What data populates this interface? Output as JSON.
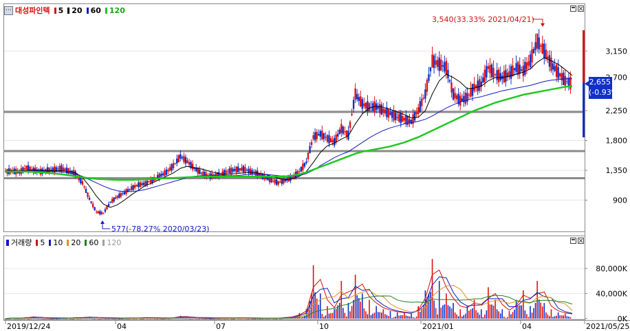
{
  "app": {
    "menu_icon": "menu-icon",
    "price_panel": {
      "stock_name": "대성파인텍",
      "ma_periods": [
        "5",
        "20",
        "60",
        "120"
      ],
      "ma_colors": [
        "#d01010",
        "#000000",
        "#1018c0",
        "#20c820"
      ]
    },
    "volume_panel": {
      "label": "거래량",
      "ma_periods": [
        "5",
        "10",
        "20",
        "60",
        "120"
      ],
      "ma_colors": [
        "#d01010",
        "#1018c0",
        "#e09020",
        "#208020",
        "#a0a0a0"
      ]
    },
    "current_price": {
      "value": "2,655",
      "change": "(-0.93%)"
    },
    "annotations": {
      "high": "3,540(33.33% 2021/04/21)",
      "low": "577(-78.27% 2020/03/23)"
    },
    "window_buttons": [
      "maximize",
      "close"
    ]
  },
  "chart_data": {
    "type": "candlestick",
    "price_axis": {
      "ticks": [
        900,
        1350,
        1800,
        2250,
        3150
      ],
      "tick_labels": [
        "900",
        "1,350",
        "1,800",
        "2,250",
        "3,150"
      ],
      "partial_label": "2,700",
      "ylim": [
        577,
        3540
      ]
    },
    "volume_axis": {
      "ticks": [
        0,
        40000,
        80000
      ],
      "tick_labels": [
        "0K",
        "40,000K",
        "80,000K"
      ]
    },
    "x_labels": [
      "2019/12/24",
      "04",
      "07",
      "10",
      "2021/01",
      "04",
      "2021/05/25"
    ],
    "support_lines": [
      2230,
      1640,
      1230
    ],
    "series": [
      {
        "name": "5",
        "values": [
          1330,
          1340,
          1320,
          1390,
          1350,
          1330,
          1350,
          1360,
          1380,
          1340,
          1300,
          1160,
          920,
          720,
          700,
          870,
          950,
          1010,
          1080,
          1130,
          1150,
          1200,
          1260,
          1320,
          1420,
          1560,
          1480,
          1380,
          1310,
          1260,
          1270,
          1300,
          1340,
          1360,
          1370,
          1330,
          1300,
          1250,
          1200,
          1160,
          1200,
          1240,
          1330,
          1470,
          1850,
          1900,
          1830,
          1780,
          1980,
          1880,
          2500,
          2350,
          2300,
          2310,
          2250,
          2200,
          2150,
          2120,
          2080,
          2250,
          2500,
          3000,
          2950,
          2900,
          2500,
          2400,
          2450,
          2600,
          2650,
          2900,
          2800,
          2750,
          2800,
          2900,
          2850,
          3000,
          3300,
          3150,
          2950,
          2820,
          2700,
          2655
        ]
      },
      {
        "name": "20",
        "values": [
          1340,
          1345,
          1340,
          1350,
          1355,
          1350,
          1345,
          1340,
          1345,
          1330,
          1310,
          1240,
          1110,
          960,
          840,
          790,
          830,
          900,
          980,
          1050,
          1120,
          1160,
          1210,
          1260,
          1310,
          1380,
          1410,
          1390,
          1370,
          1340,
          1310,
          1290,
          1290,
          1300,
          1310,
          1320,
          1310,
          1290,
          1260,
          1230,
          1210,
          1220,
          1260,
          1330,
          1470,
          1620,
          1720,
          1760,
          1820,
          1870,
          2050,
          2200,
          2290,
          2320,
          2300,
          2270,
          2230,
          2190,
          2140,
          2150,
          2250,
          2500,
          2700,
          2800,
          2750,
          2680,
          2580,
          2590,
          2620,
          2700,
          2750,
          2750,
          2770,
          2800,
          2830,
          2880,
          2980,
          3050,
          3000,
          2950,
          2870,
          2780
        ]
      },
      {
        "name": "60",
        "values": [
          1320,
          1325,
          1330,
          1335,
          1340,
          1340,
          1335,
          1330,
          1325,
          1310,
          1290,
          1260,
          1210,
          1160,
          1110,
          1070,
          1040,
          1030,
          1030,
          1040,
          1060,
          1090,
          1120,
          1150,
          1180,
          1210,
          1240,
          1260,
          1270,
          1270,
          1270,
          1270,
          1270,
          1270,
          1280,
          1290,
          1295,
          1290,
          1280,
          1270,
          1260,
          1260,
          1270,
          1300,
          1350,
          1420,
          1480,
          1540,
          1590,
          1630,
          1700,
          1770,
          1840,
          1900,
          1950,
          1990,
          2020,
          2050,
          2070,
          2090,
          2120,
          2170,
          2230,
          2290,
          2340,
          2380,
          2410,
          2440,
          2460,
          2490,
          2520,
          2550,
          2570,
          2590,
          2610,
          2630,
          2660,
          2690,
          2710,
          2720,
          2730,
          2730
        ]
      },
      {
        "name": "120",
        "values": [
          1330,
          1330,
          1330,
          1330,
          1325,
          1320,
          1310,
          1300,
          1290,
          1275,
          1260,
          1245,
          1230,
          1220,
          1215,
          1210,
          1205,
          1205,
          1205,
          1210,
          1215,
          1220,
          1225,
          1230,
          1235,
          1240,
          1245,
          1250,
          1255,
          1255,
          1255,
          1255,
          1255,
          1255,
          1255,
          1255,
          1255,
          1255,
          1255,
          1255,
          1260,
          1270,
          1290,
          1320,
          1360,
          1400,
          1440,
          1480,
          1520,
          1560,
          1600,
          1630,
          1650,
          1670,
          1690,
          1710,
          1740,
          1770,
          1810,
          1850,
          1900,
          1950,
          2000,
          2050,
          2100,
          2150,
          2200,
          2250,
          2290,
          2330,
          2370,
          2400,
          2430,
          2460,
          2490,
          2510,
          2530,
          2550,
          2570,
          2590,
          2610,
          2620
        ]
      },
      {
        "name": "거래량",
        "values": [
          400,
          1200,
          600,
          2500,
          3000,
          900,
          600,
          400,
          800,
          1000,
          2000,
          1500,
          3000,
          1200,
          900,
          800,
          600,
          700,
          900,
          1200,
          2000,
          1000,
          800,
          900,
          2000,
          4500,
          2000,
          1200,
          800,
          600,
          500,
          700,
          900,
          1500,
          900,
          700,
          500,
          600,
          800,
          900,
          2500,
          3000,
          9000,
          15000,
          85000,
          40000,
          20000,
          15000,
          60000,
          25000,
          70000,
          40000,
          30000,
          20000,
          15000,
          12000,
          10000,
          9000,
          8000,
          20000,
          45000,
          95000,
          60000,
          40000,
          25000,
          15000,
          20000,
          30000,
          15000,
          50000,
          30000,
          15000,
          12000,
          30000,
          45000,
          20000,
          60000,
          25000,
          15000,
          10000,
          8000,
          7000
        ]
      }
    ]
  }
}
